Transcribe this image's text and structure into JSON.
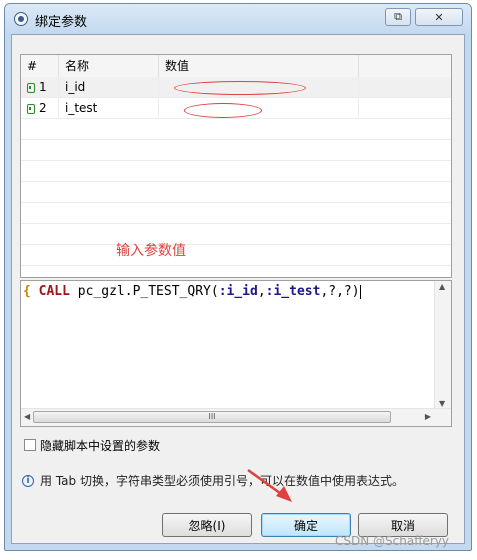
{
  "window": {
    "title": "绑定参数",
    "restore_glyph": "⧉",
    "close_glyph": "✕"
  },
  "grid": {
    "columns": [
      "#",
      "名称",
      "数值"
    ],
    "rows": [
      {
        "index": "1",
        "name": "i_id",
        "value": ""
      },
      {
        "index": "2",
        "name": "i_test",
        "value": ""
      }
    ]
  },
  "annotation": {
    "hint": "输入参数值",
    "color": "#e04040"
  },
  "editor": {
    "brace": "{",
    "keyword": "CALL",
    "proc": " pc_gzl.P_TEST_QRY(",
    "param1": ":i_id",
    "comma1": ",",
    "param2": ":i_test",
    "tail": ",?,?)",
    "hthumb_grip": "III"
  },
  "options": {
    "hide_params_label": "隐藏脚本中设置的参数"
  },
  "info": {
    "text": "用 Tab 切换，字符串类型必须使用引号，可以在数值中使用表达式。"
  },
  "buttons": {
    "ignore": "忽略(I)",
    "ok": "确定",
    "cancel": "取消"
  },
  "watermark": "CSDN @Schafferyy"
}
